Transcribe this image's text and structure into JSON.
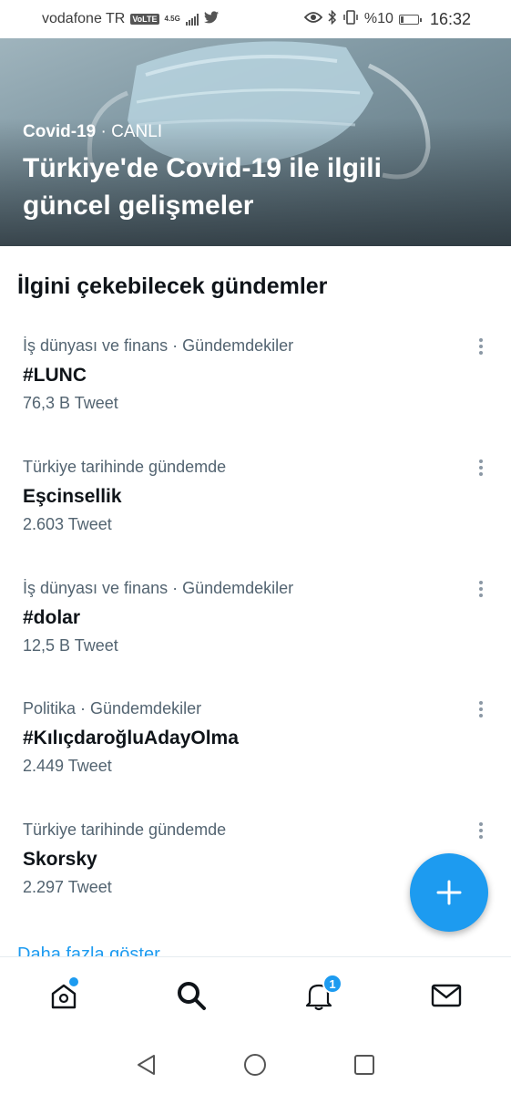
{
  "status_bar": {
    "carrier": "vodafone TR",
    "volte": "VoLTE",
    "network": "4.5G",
    "battery_text": "%10",
    "time": "16:32",
    "icons": [
      "twitter-bird-icon",
      "eye-icon",
      "bluetooth-icon",
      "vibrate-icon",
      "battery-icon"
    ]
  },
  "hero": {
    "topic": "Covid-19",
    "separator": " · ",
    "live_label": "CANLI",
    "title": "Türkiye'de Covid-19 ile ilgili güncel gelişmeler"
  },
  "section": {
    "title": "İlgini çekebilecek gündemler"
  },
  "trends": [
    {
      "context": "İş dünyası ve finans · Gündemdekiler",
      "name": "#LUNC",
      "count": "76,3 B Tweet"
    },
    {
      "context": "Türkiye tarihinde gündemde",
      "name": "Eşcinsellik",
      "count": "2.603 Tweet"
    },
    {
      "context": "İş dünyası ve finans · Gündemdekiler",
      "name": "#dolar",
      "count": "12,5 B Tweet"
    },
    {
      "context": "Politika · Gündemdekiler",
      "name": "#KılıçdaroğluAdayOlma",
      "count": "2.449 Tweet"
    },
    {
      "context": "Türkiye tarihinde gündemde",
      "name": "Skorsky",
      "count": "2.297 Tweet"
    }
  ],
  "show_more": "Daha fazla göster",
  "fab_icon": "plus-icon",
  "bottom_nav": {
    "items": [
      "home-icon",
      "search-icon",
      "notifications-icon",
      "messages-icon"
    ],
    "notifications_badge": "1"
  },
  "android_nav": [
    "back-icon",
    "home-circle-icon",
    "recents-icon"
  ],
  "colors": {
    "accent": "#1d9bf0",
    "text": "#0f1419",
    "secondary": "#536471"
  }
}
